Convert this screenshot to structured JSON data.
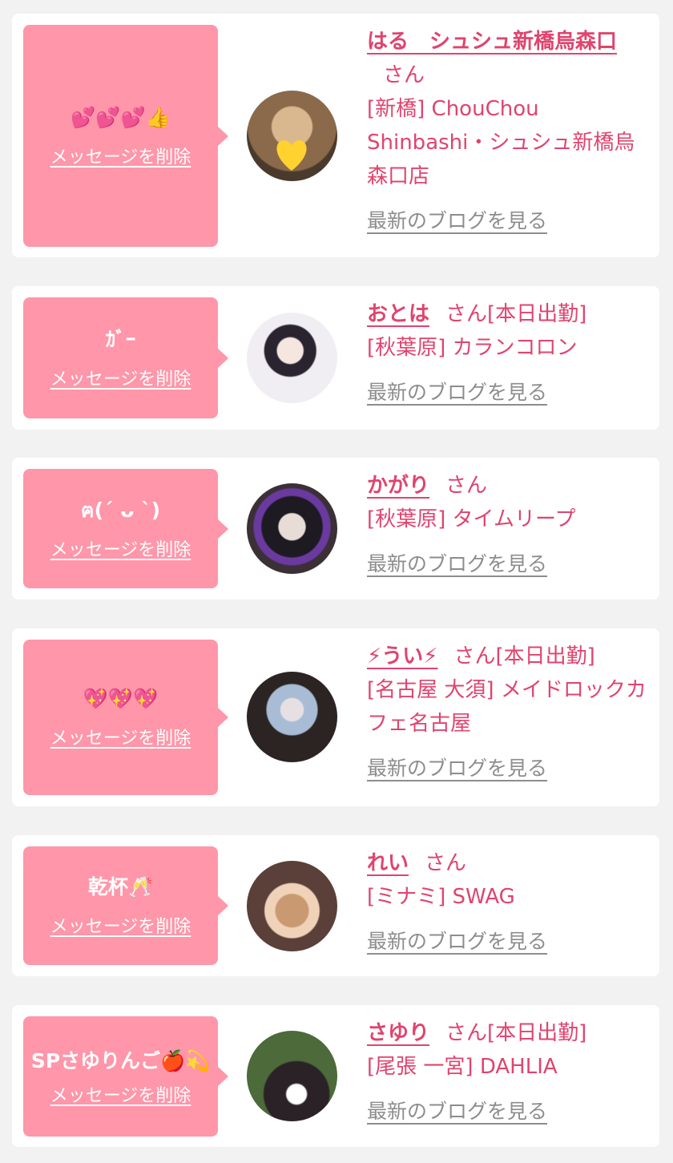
{
  "entries": [
    {
      "message": "💕💕💕👍",
      "delete_label": "メッセージを削除",
      "name": "はる　シュシュ新橋烏森口",
      "suffix": "さん",
      "status": "",
      "location": "[新橋] ChouChou Shinbashi・シュシュ新橋烏森口店",
      "blog_label": "最新のブログを見る",
      "avatar_colors": [
        "#8a6a4a",
        "#d9b890"
      ]
    },
    {
      "message": "ｶﾞｰ",
      "delete_label": "メッセージを削除",
      "name": "おとは",
      "suffix": "さん",
      "status": "[本日出勤]",
      "location": "[秋葉原] カランコロン",
      "blog_label": "最新のブログを見る",
      "avatar_colors": [
        "#f0eef2",
        "#2a2430"
      ]
    },
    {
      "message": "ฅ(ˊ ᴗ ˋ)",
      "delete_label": "メッセージを削除",
      "name": "かがり",
      "suffix": "さん",
      "status": "",
      "location": "[秋葉原] タイムリープ",
      "blog_label": "最新のブログを見る",
      "avatar_colors": [
        "#3a3036",
        "#e8dcd6"
      ]
    },
    {
      "message": "💖💖💖",
      "delete_label": "メッセージを削除",
      "name": "⚡うい⚡",
      "suffix": "さん",
      "status": "[本日出勤]",
      "location": "[名古屋 大須] メイドロックカフェ名古屋",
      "blog_label": "最新のブログを見る",
      "avatar_colors": [
        "#2b2422",
        "#a8bcd6"
      ]
    },
    {
      "message": "乾杯🥂",
      "delete_label": "メッセージを削除",
      "name": "れい",
      "suffix": "さん",
      "status": "",
      "location": "[ミナミ] SWAG",
      "blog_label": "最新のブログを見る",
      "avatar_colors": [
        "#5a4038",
        "#f0d2b8"
      ]
    },
    {
      "message": "SPさゆりんご🍎💫",
      "delete_label": "メッセージを削除",
      "name": "さゆり",
      "suffix": "さん",
      "status": "[本日出勤]",
      "location": "[尾張 一宮] DAHLIA",
      "blog_label": "最新のブログを見る",
      "avatar_colors": [
        "#4c6a3a",
        "#2a2226"
      ]
    }
  ]
}
